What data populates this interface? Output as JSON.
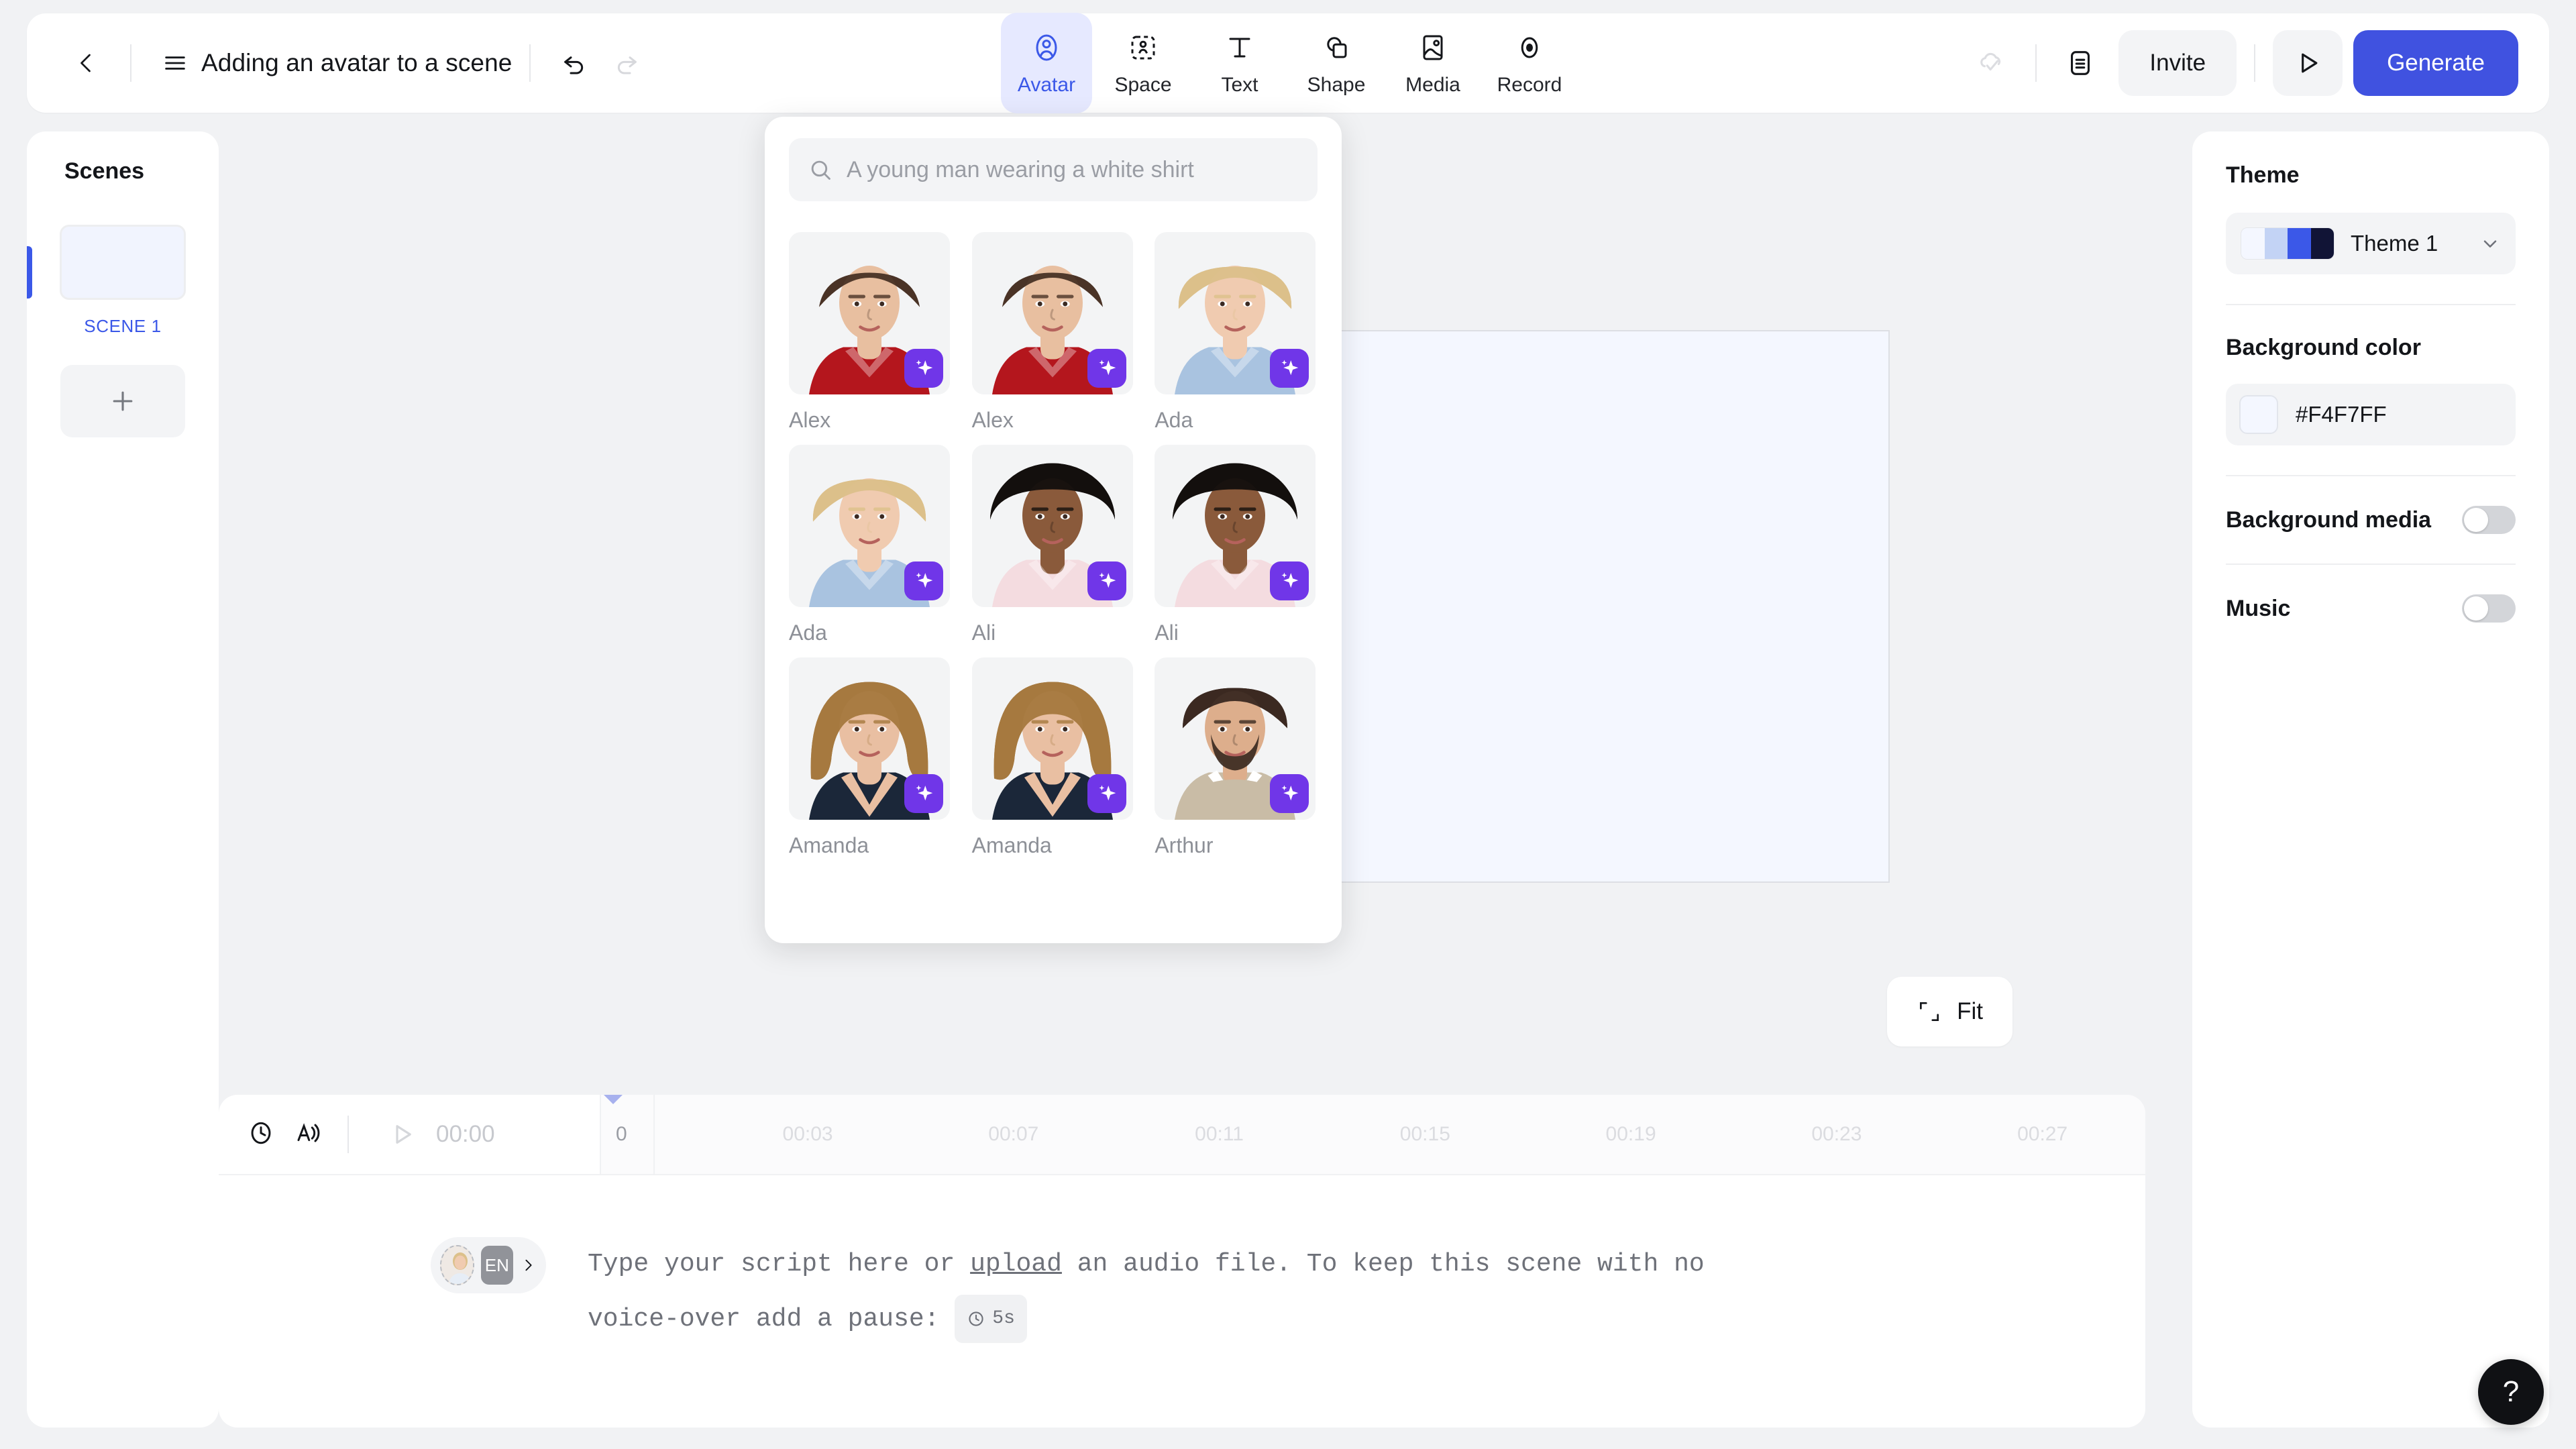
{
  "header": {
    "back_icon": "chevron-left-icon",
    "menu_icon": "hamburger-menu-icon",
    "title": "Adding an avatar to a scene",
    "undo_icon": "undo-icon",
    "redo_icon": "redo-icon",
    "cloud_icon": "cloud-saved-icon",
    "notes_icon": "document-icon",
    "invite_label": "Invite",
    "preview_icon": "play-icon",
    "generate_label": "Generate"
  },
  "toolbar": {
    "items": [
      {
        "label": "Avatar",
        "icon": "avatar-icon",
        "active": true
      },
      {
        "label": "Space",
        "icon": "space-icon",
        "active": false
      },
      {
        "label": "Text",
        "icon": "text-icon",
        "active": false
      },
      {
        "label": "Shape",
        "icon": "shape-icon",
        "active": false
      },
      {
        "label": "Media",
        "icon": "media-icon",
        "active": false
      },
      {
        "label": "Record",
        "icon": "record-icon",
        "active": false
      }
    ]
  },
  "scenes": {
    "title": "Scenes",
    "items": [
      {
        "label": "SCENE 1",
        "selected": true
      }
    ],
    "add_icon": "plus-icon"
  },
  "avatar_picker": {
    "search_placeholder": "A young man wearing a white shirt",
    "search_icon": "search-icon",
    "badge_icon": "sparkle-icon",
    "avatars": [
      {
        "name": "Alex",
        "hair": "#4A3326",
        "skin": "#E8BFA0",
        "shirt": "#B4161D",
        "style": "updo"
      },
      {
        "name": "Alex",
        "hair": "#4A3326",
        "skin": "#E8BFA0",
        "shirt": "#B4161D",
        "style": "updo"
      },
      {
        "name": "Ada",
        "hair": "#DCC08A",
        "skin": "#F0CBB0",
        "shirt": "#A9C3E0",
        "style": "short"
      },
      {
        "name": "Ada",
        "hair": "#DCC08A",
        "skin": "#F0CBB0",
        "shirt": "#A9C3E0",
        "style": "short"
      },
      {
        "name": "Ali",
        "hair": "#14100E",
        "skin": "#8A5A3B",
        "shirt": "#F4DCE0",
        "style": "afro"
      },
      {
        "name": "Ali",
        "hair": "#14100E",
        "skin": "#8A5A3B",
        "shirt": "#F4DCE0",
        "style": "afro"
      },
      {
        "name": "Amanda",
        "hair": "#A5793F",
        "skin": "#E9BFA2",
        "shirt": "#1B2739",
        "style": "long"
      },
      {
        "name": "Amanda",
        "hair": "#A5793F",
        "skin": "#E9BFA2",
        "shirt": "#1B2739",
        "style": "long"
      },
      {
        "name": "Arthur",
        "hair": "#3B2A21",
        "skin": "#DDAE8C",
        "shirt": "#C9BCA6",
        "style": "beard"
      }
    ]
  },
  "stage": {
    "fit_label": "Fit",
    "fit_icon": "fit-frame-icon",
    "canvas_color": "#F4F7FF"
  },
  "theme_panel": {
    "theme_label": "Theme",
    "theme_name": "Theme 1",
    "theme_swatches": [
      "#F4F7FF",
      "#C3D3F5",
      "#3B58E8",
      "#111436"
    ],
    "chevron_icon": "chevron-down-icon",
    "background_color_label": "Background color",
    "background_color_value": "#F4F7FF",
    "background_media_label": "Background media",
    "background_media_on": false,
    "music_label": "Music",
    "music_on": false
  },
  "timeline": {
    "clock_icon": "clock-icon",
    "voice_icon": "text-to-speech-icon",
    "play_icon": "play-icon",
    "current_time": "00:00",
    "zero_label": "0",
    "ticks": [
      "00:03",
      "00:07",
      "00:11",
      "00:15",
      "00:19",
      "00:23",
      "00:27"
    ],
    "playhead_position": 0
  },
  "script": {
    "language_badge": "EN",
    "expand_icon": "chevron-right-icon",
    "avatar_icon": "speaker-avatar-icon",
    "line1_before": "Type your script here or ",
    "line1_link": "upload",
    "line1_after": " an audio file. To keep this scene with no",
    "line2_before": "voice-over add a pause: ",
    "pause_icon": "clock-icon",
    "pause_label": "5s"
  },
  "help": {
    "label": "?",
    "icon": "question-mark-icon"
  },
  "colors": {
    "accent": "#4052E0",
    "accent_light": "#E6E9FF",
    "badge_purple": "#7036E8",
    "panel_bg": "#FFFFFF",
    "app_bg": "#F1F2F4"
  }
}
